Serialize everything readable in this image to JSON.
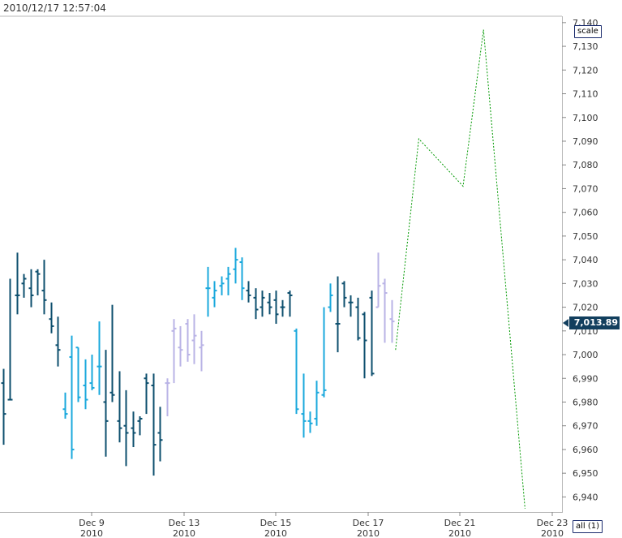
{
  "header": {
    "timestamp": "2010/12/17 12:57:04"
  },
  "controls": {
    "scale_label": "scale",
    "all_label": "all (1)"
  },
  "last_price": {
    "label": "7,013.89",
    "value": 7013.89
  },
  "chart_data": {
    "type": "ohlc",
    "y_axis": {
      "ylim": [
        6935,
        7142
      ],
      "ticks": [
        6940,
        6950,
        6960,
        6970,
        6980,
        6990,
        7000,
        7010,
        7020,
        7030,
        7040,
        7050,
        7060,
        7070,
        7080,
        7090,
        7100,
        7110,
        7120,
        7130,
        7140
      ],
      "tick_labels": [
        "6,940",
        "6,950",
        "6,960",
        "6,970",
        "6,980",
        "6,990",
        "7,000",
        "7,010",
        "7,020",
        "7,030",
        "7,040",
        "7,050",
        "7,060",
        "7,070",
        "7,080",
        "7,090",
        "7,100",
        "7,110",
        "7,120",
        "7,130",
        "7,140"
      ],
      "position": "right"
    },
    "x_axis": {
      "ticks": [
        {
          "day": "Dec 9",
          "year": "2010"
        },
        {
          "day": "Dec 13",
          "year": "2010"
        },
        {
          "day": "Dec 15",
          "year": "2010"
        },
        {
          "day": "Dec 17",
          "year": "2010"
        },
        {
          "day": "Dec 21",
          "year": "2010"
        },
        {
          "day": "Dec 23",
          "year": "2010"
        }
      ]
    },
    "series_colors": {
      "dark": "#0d4f6e",
      "cyan": "#1aa8dc",
      "lavender": "#b9b3e6",
      "forecast": "#009900"
    },
    "bars": [
      {
        "group": "dark",
        "o": 6988,
        "h": 6994,
        "l": 6962,
        "c": 6975
      },
      {
        "group": "dark",
        "o": 6981,
        "h": 7032,
        "l": 6981,
        "c": 6981
      },
      {
        "group": "dark",
        "o": 7025,
        "h": 7043,
        "l": 7017,
        "c": 7025
      },
      {
        "group": "dark",
        "o": 7030,
        "h": 7034,
        "l": 7024,
        "c": 7032
      },
      {
        "group": "dark",
        "o": 7028,
        "h": 7036,
        "l": 7020,
        "c": 7025
      },
      {
        "group": "dark",
        "o": 7035,
        "h": 7036,
        "l": 7025,
        "c": 7034
      },
      {
        "group": "dark",
        "o": 7027,
        "h": 7040,
        "l": 7017,
        "c": 7023
      },
      {
        "group": "dark",
        "o": 7015,
        "h": 7022,
        "l": 7009,
        "c": 7012
      },
      {
        "group": "dark",
        "o": 7004,
        "h": 7016,
        "l": 6995,
        "c": 7002
      },
      {
        "group": "cyan",
        "o": 6977,
        "h": 6984,
        "l": 6973,
        "c": 6975
      },
      {
        "group": "cyan",
        "o": 6999,
        "h": 7008,
        "l": 6956,
        "c": 6960
      },
      {
        "group": "cyan",
        "o": 7003,
        "h": 7003,
        "l": 6980,
        "c": 6982
      },
      {
        "group": "cyan",
        "o": 6987,
        "h": 6998,
        "l": 6977,
        "c": 6981
      },
      {
        "group": "cyan",
        "o": 6988,
        "h": 7000,
        "l": 6985,
        "c": 6986
      },
      {
        "group": "cyan",
        "o": 6995,
        "h": 7014,
        "l": 6983,
        "c": 6995
      },
      {
        "group": "dark",
        "o": 6980,
        "h": 7002,
        "l": 6957,
        "c": 6972
      },
      {
        "group": "dark",
        "o": 6984,
        "h": 7021,
        "l": 6980,
        "c": 6983
      },
      {
        "group": "dark",
        "o": 6972,
        "h": 6993,
        "l": 6963,
        "c": 6969
      },
      {
        "group": "dark",
        "o": 6970,
        "h": 6985,
        "l": 6953,
        "c": 6967
      },
      {
        "group": "dark",
        "o": 6969,
        "h": 6976,
        "l": 6961,
        "c": 6967
      },
      {
        "group": "dark",
        "o": 6972,
        "h": 6974,
        "l": 6966,
        "c": 6973
      },
      {
        "group": "dark",
        "o": 6990,
        "h": 6992,
        "l": 6975,
        "c": 6988
      },
      {
        "group": "dark",
        "o": 6987,
        "h": 6992,
        "l": 6949,
        "c": 6962
      },
      {
        "group": "dark",
        "o": 6967,
        "h": 6978,
        "l": 6955,
        "c": 6964
      },
      {
        "group": "lavender",
        "o": 6988,
        "h": 6990,
        "l": 6974,
        "c": 6988
      },
      {
        "group": "lavender",
        "o": 7010,
        "h": 7015,
        "l": 6988,
        "c": 7011
      },
      {
        "group": "lavender",
        "o": 7003,
        "h": 7012,
        "l": 6995,
        "c": 7002
      },
      {
        "group": "lavender",
        "o": 7013,
        "h": 7015,
        "l": 6997,
        "c": 7000
      },
      {
        "group": "lavender",
        "o": 7006,
        "h": 7017,
        "l": 6996,
        "c": 7008
      },
      {
        "group": "lavender",
        "o": 7003,
        "h": 7010,
        "l": 6993,
        "c": 7004
      },
      {
        "group": "cyan",
        "o": 7028,
        "h": 7037,
        "l": 7016,
        "c": 7028
      },
      {
        "group": "cyan",
        "o": 7024,
        "h": 7031,
        "l": 7020,
        "c": 7027
      },
      {
        "group": "cyan",
        "o": 7029,
        "h": 7033,
        "l": 7025,
        "c": 7030
      },
      {
        "group": "cyan",
        "o": 7032,
        "h": 7037,
        "l": 7025,
        "c": 7034
      },
      {
        "group": "cyan",
        "o": 7036,
        "h": 7045,
        "l": 7030,
        "c": 7040
      },
      {
        "group": "cyan",
        "o": 7039,
        "h": 7041,
        "l": 7023,
        "c": 7028
      },
      {
        "group": "dark",
        "o": 7027,
        "h": 7031,
        "l": 7022,
        "c": 7025
      },
      {
        "group": "dark",
        "o": 7024,
        "h": 7028,
        "l": 7015,
        "c": 7019
      },
      {
        "group": "dark",
        "o": 7020,
        "h": 7027,
        "l": 7016,
        "c": 7024
      },
      {
        "group": "dark",
        "o": 7022,
        "h": 7026,
        "l": 7017,
        "c": 7020
      },
      {
        "group": "dark",
        "o": 7023,
        "h": 7027,
        "l": 7013,
        "c": 7017
      },
      {
        "group": "dark",
        "o": 7020,
        "h": 7023,
        "l": 7016,
        "c": 7020
      },
      {
        "group": "dark",
        "o": 7026,
        "h": 7027,
        "l": 7016,
        "c": 7025
      },
      {
        "group": "cyan",
        "o": 7010,
        "h": 7011,
        "l": 6975,
        "c": 6977
      },
      {
        "group": "cyan",
        "o": 6975,
        "h": 6992,
        "l": 6965,
        "c": 6972
      },
      {
        "group": "cyan",
        "o": 6972,
        "h": 6976,
        "l": 6967,
        "c": 6971
      },
      {
        "group": "cyan",
        "o": 6973,
        "h": 6989,
        "l": 6970,
        "c": 6984
      },
      {
        "group": "cyan",
        "o": 6983,
        "h": 7020,
        "l": 6982,
        "c": 6985
      },
      {
        "group": "cyan",
        "o": 7020,
        "h": 7030,
        "l": 7018,
        "c": 7025
      },
      {
        "group": "dark",
        "o": 7013,
        "h": 7033,
        "l": 7001,
        "c": 7013
      },
      {
        "group": "dark",
        "o": 7030,
        "h": 7031,
        "l": 7020,
        "c": 7024
      },
      {
        "group": "dark",
        "o": 7022,
        "h": 7025,
        "l": 7016,
        "c": 7022
      },
      {
        "group": "dark",
        "o": 7020,
        "h": 7024,
        "l": 7006,
        "c": 7007
      },
      {
        "group": "dark",
        "o": 7017,
        "h": 7018,
        "l": 6990,
        "c": 7006
      },
      {
        "group": "dark",
        "o": 7024,
        "h": 7027,
        "l": 6991,
        "c": 6992
      },
      {
        "group": "lavender",
        "o": 7020,
        "h": 7043,
        "l": 7020,
        "c": 7029
      },
      {
        "group": "lavender",
        "o": 7030,
        "h": 7032,
        "l": 7005,
        "c": 7026
      },
      {
        "group": "lavender",
        "o": 7015,
        "h": 7023,
        "l": 7005,
        "c": 7014
      }
    ],
    "forecast": {
      "style": "dotted",
      "points": [
        {
          "i": 57.6,
          "v": 7002
        },
        {
          "i": 61.0,
          "v": 7091
        },
        {
          "i": 67.5,
          "v": 7071
        },
        {
          "i": 70.5,
          "v": 7137
        },
        {
          "i": 76.6,
          "v": 6935
        }
      ]
    }
  }
}
